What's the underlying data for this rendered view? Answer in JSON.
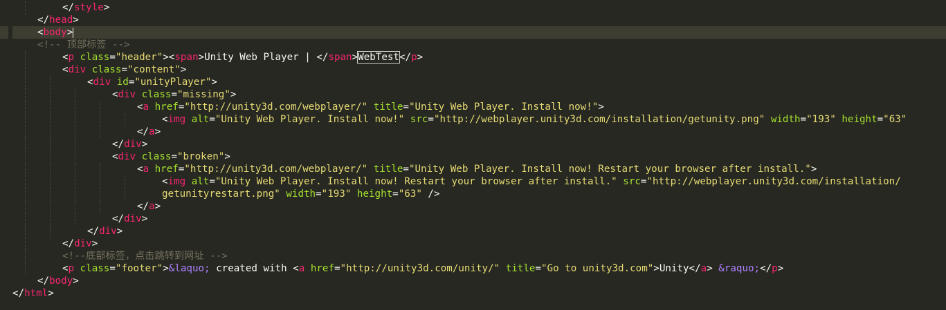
{
  "colors": {
    "background": "#272822",
    "text": "#f8f8f2",
    "tag": "#f92672",
    "attribute": "#a6e22e",
    "string": "#e6db74",
    "comment": "#75715e",
    "entity": "#ae81ff"
  },
  "lines": [
    {
      "indent": 2,
      "tokens": [
        [
          "p",
          "</"
        ],
        [
          "t",
          "style"
        ],
        [
          "p",
          ">"
        ]
      ]
    },
    {
      "indent": 1,
      "tokens": [
        [
          "p",
          "</"
        ],
        [
          "t",
          "head"
        ],
        [
          "p",
          ">"
        ]
      ]
    },
    {
      "indent": 1,
      "current": true,
      "tokens": [
        [
          "p",
          "<"
        ],
        [
          "t",
          "body"
        ],
        [
          "p",
          ">"
        ]
      ]
    },
    {
      "indent": 1,
      "tokens": [
        [
          "c",
          "<!-- 顶部标签 -->"
        ]
      ]
    },
    {
      "indent": 2,
      "tokens": [
        [
          "p",
          "<"
        ],
        [
          "t",
          "p"
        ],
        [
          "p",
          " "
        ],
        [
          "a",
          "class"
        ],
        [
          "p",
          "="
        ],
        [
          "s",
          "\"header\""
        ],
        [
          "p",
          ">"
        ],
        [
          "p",
          "<"
        ],
        [
          "t",
          "span"
        ],
        [
          "p",
          ">"
        ],
        [
          "p",
          "Unity Web Player | "
        ],
        [
          "p",
          "</"
        ],
        [
          "t",
          "span"
        ],
        [
          "p",
          ">"
        ],
        [
          "boxed",
          "WebTest"
        ],
        [
          "p",
          "</"
        ],
        [
          "t",
          "p"
        ],
        [
          "p",
          ">"
        ]
      ]
    },
    {
      "indent": 2,
      "tokens": [
        [
          "p",
          "<"
        ],
        [
          "t",
          "div"
        ],
        [
          "p",
          " "
        ],
        [
          "a",
          "class"
        ],
        [
          "p",
          "="
        ],
        [
          "s",
          "\"content\""
        ],
        [
          "p",
          ">"
        ]
      ]
    },
    {
      "indent": 3,
      "tokens": [
        [
          "p",
          "<"
        ],
        [
          "t",
          "div"
        ],
        [
          "p",
          " "
        ],
        [
          "a",
          "id"
        ],
        [
          "p",
          "="
        ],
        [
          "s",
          "\"unityPlayer\""
        ],
        [
          "p",
          ">"
        ]
      ]
    },
    {
      "indent": 4,
      "tokens": [
        [
          "p",
          "<"
        ],
        [
          "t",
          "div"
        ],
        [
          "p",
          " "
        ],
        [
          "a",
          "class"
        ],
        [
          "p",
          "="
        ],
        [
          "s",
          "\"missing\""
        ],
        [
          "p",
          ">"
        ]
      ]
    },
    {
      "indent": 5,
      "tokens": [
        [
          "p",
          "<"
        ],
        [
          "t",
          "a"
        ],
        [
          "p",
          " "
        ],
        [
          "a",
          "href"
        ],
        [
          "p",
          "="
        ],
        [
          "s",
          "\"http://unity3d.com/webplayer/\""
        ],
        [
          "p",
          " "
        ],
        [
          "a",
          "title"
        ],
        [
          "p",
          "="
        ],
        [
          "s",
          "\"Unity Web Player. Install now!\""
        ],
        [
          "p",
          ">"
        ]
      ]
    },
    {
      "indent": 6,
      "tokens": [
        [
          "p",
          "<"
        ],
        [
          "t",
          "img"
        ],
        [
          "p",
          " "
        ],
        [
          "a",
          "alt"
        ],
        [
          "p",
          "="
        ],
        [
          "s",
          "\"Unity Web Player. Install now!\""
        ],
        [
          "p",
          " "
        ],
        [
          "a",
          "src"
        ],
        [
          "p",
          "="
        ],
        [
          "s",
          "\"http://webplayer.unity3d.com/installation/getunity.png\""
        ],
        [
          "p",
          " "
        ],
        [
          "a",
          "width"
        ],
        [
          "p",
          "="
        ],
        [
          "s",
          "\"193\""
        ],
        [
          "p",
          " "
        ],
        [
          "a",
          "height"
        ],
        [
          "p",
          "="
        ],
        [
          "s",
          "\"63\""
        ]
      ]
    },
    {
      "indent": 5,
      "tokens": [
        [
          "p",
          "</"
        ],
        [
          "t",
          "a"
        ],
        [
          "p",
          ">"
        ]
      ]
    },
    {
      "indent": 4,
      "tokens": [
        [
          "p",
          "</"
        ],
        [
          "t",
          "div"
        ],
        [
          "p",
          ">"
        ]
      ]
    },
    {
      "indent": 4,
      "tokens": [
        [
          "p",
          "<"
        ],
        [
          "t",
          "div"
        ],
        [
          "p",
          " "
        ],
        [
          "a",
          "class"
        ],
        [
          "p",
          "="
        ],
        [
          "s",
          "\"broken\""
        ],
        [
          "p",
          ">"
        ]
      ]
    },
    {
      "indent": 5,
      "tokens": [
        [
          "p",
          "<"
        ],
        [
          "t",
          "a"
        ],
        [
          "p",
          " "
        ],
        [
          "a",
          "href"
        ],
        [
          "p",
          "="
        ],
        [
          "s",
          "\"http://unity3d.com/webplayer/\""
        ],
        [
          "p",
          " "
        ],
        [
          "a",
          "title"
        ],
        [
          "p",
          "="
        ],
        [
          "s",
          "\"Unity Web Player. Install now! Restart your browser after install.\""
        ],
        [
          "p",
          ">"
        ]
      ]
    },
    {
      "indent": 6,
      "tokens": [
        [
          "p",
          "<"
        ],
        [
          "t",
          "img"
        ],
        [
          "p",
          " "
        ],
        [
          "a",
          "alt"
        ],
        [
          "p",
          "="
        ],
        [
          "s",
          "\"Unity Web Player. Install now! Restart your browser after install.\""
        ],
        [
          "p",
          " "
        ],
        [
          "a",
          "src"
        ],
        [
          "p",
          "="
        ],
        [
          "s",
          "\"http://webplayer.unity3d.com/installation/"
        ]
      ]
    },
    {
      "indent": 6,
      "guides": 5,
      "tokens": [
        [
          "s",
          "getunityrestart.png\""
        ],
        [
          "p",
          " "
        ],
        [
          "a",
          "width"
        ],
        [
          "p",
          "="
        ],
        [
          "s",
          "\"193\""
        ],
        [
          "p",
          " "
        ],
        [
          "a",
          "height"
        ],
        [
          "p",
          "="
        ],
        [
          "s",
          "\"63\""
        ],
        [
          "p",
          " />"
        ]
      ]
    },
    {
      "indent": 5,
      "tokens": [
        [
          "p",
          "</"
        ],
        [
          "t",
          "a"
        ],
        [
          "p",
          ">"
        ]
      ]
    },
    {
      "indent": 4,
      "tokens": [
        [
          "p",
          "</"
        ],
        [
          "t",
          "div"
        ],
        [
          "p",
          ">"
        ]
      ]
    },
    {
      "indent": 3,
      "tokens": [
        [
          "p",
          "</"
        ],
        [
          "t",
          "div"
        ],
        [
          "p",
          ">"
        ]
      ]
    },
    {
      "indent": 2,
      "tokens": [
        [
          "p",
          "</"
        ],
        [
          "t",
          "div"
        ],
        [
          "p",
          ">"
        ]
      ]
    },
    {
      "indent": 2,
      "tokens": [
        [
          "c",
          "<!--底部标签，点击跳转到网址 -->"
        ]
      ]
    },
    {
      "indent": 2,
      "tokens": [
        [
          "p",
          "<"
        ],
        [
          "t",
          "p"
        ],
        [
          "p",
          " "
        ],
        [
          "a",
          "class"
        ],
        [
          "p",
          "="
        ],
        [
          "s",
          "\"footer\""
        ],
        [
          "p",
          ">"
        ],
        [
          "e",
          "&laquo;"
        ],
        [
          "p",
          " created with "
        ],
        [
          "p",
          "<"
        ],
        [
          "t",
          "a"
        ],
        [
          "p",
          " "
        ],
        [
          "a",
          "href"
        ],
        [
          "p",
          "="
        ],
        [
          "s",
          "\"http://unity3d.com/unity/\""
        ],
        [
          "p",
          " "
        ],
        [
          "a",
          "title"
        ],
        [
          "p",
          "="
        ],
        [
          "s",
          "\"Go to unity3d.com\""
        ],
        [
          "p",
          ">"
        ],
        [
          "p",
          "Unity"
        ],
        [
          "p",
          "</"
        ],
        [
          "t",
          "a"
        ],
        [
          "p",
          "> "
        ],
        [
          "e",
          "&raquo;"
        ],
        [
          "p",
          "</"
        ],
        [
          "t",
          "p"
        ],
        [
          "p",
          ">"
        ]
      ]
    },
    {
      "indent": 1,
      "tokens": [
        [
          "p",
          "</"
        ],
        [
          "t",
          "body"
        ],
        [
          "p",
          ">"
        ]
      ]
    },
    {
      "indent": 0,
      "tokens": [
        [
          "p",
          "</"
        ],
        [
          "t",
          "html"
        ],
        [
          "p",
          ">"
        ]
      ]
    }
  ]
}
